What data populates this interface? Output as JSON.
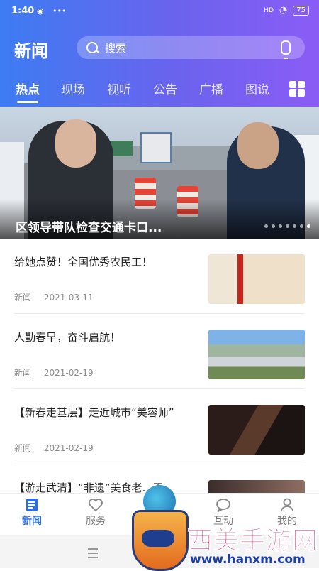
{
  "status_bar": {
    "time": "1:40",
    "dots": "•••",
    "battery": "75",
    "signal": "HD"
  },
  "header": {
    "title": "新闻",
    "search_placeholder": "搜索",
    "tabs": [
      {
        "label": "热点",
        "active": true
      },
      {
        "label": "现场",
        "active": false
      },
      {
        "label": "视听",
        "active": false
      },
      {
        "label": "公告",
        "active": false
      },
      {
        "label": "广播",
        "active": false
      },
      {
        "label": "图说",
        "active": false
      }
    ]
  },
  "banner": {
    "title": "区领导带队检查交通卡口...",
    "slide_count": 7,
    "active_slide": 6
  },
  "news": [
    {
      "title": "给她点赞！全国优秀农民工！",
      "category": "新闻",
      "date": "2021-03-11"
    },
    {
      "title": "人勤春早，奋斗启航！",
      "category": "新闻",
      "date": "2021-02-19"
    },
    {
      "title": "【新春走基层】走近城市“美容师”",
      "category": "新闻",
      "date": "2021-02-19"
    },
    {
      "title": "【游走武清】“非遗”美食老…王",
      "category": "",
      "date": ""
    }
  ],
  "bottom_nav": [
    {
      "label": "新闻",
      "icon": "news-icon",
      "active": true
    },
    {
      "label": "服务",
      "icon": "heart-icon",
      "active": false
    },
    {
      "label": "",
      "icon": "app-logo-icon",
      "active": false
    },
    {
      "label": "互动",
      "icon": "chat-icon",
      "active": false
    },
    {
      "label": "我的",
      "icon": "user-icon",
      "active": false
    }
  ],
  "watermark": {
    "text": "西美手游网",
    "url": "www.hanxm.com"
  },
  "colors": {
    "brand_start": "#3d7cf2",
    "brand_end": "#8b5cf6",
    "active_nav": "#2f6fe6"
  }
}
